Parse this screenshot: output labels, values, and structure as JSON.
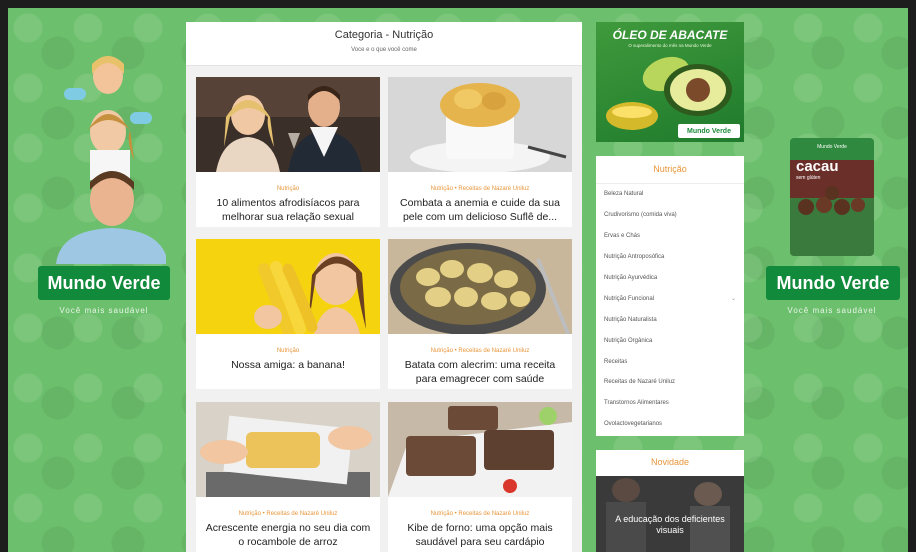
{
  "left_ad": {
    "brand": "Mundo Verde",
    "slogan": "Você mais saudável"
  },
  "right_ad": {
    "brand": "Mundo Verde",
    "slogan": "Você mais saudável",
    "product_brand": "Mundo Verde",
    "product_name": "cacau",
    "product_flag": "sem glúten"
  },
  "category": {
    "title": "Categoria - Nutrição",
    "subtitle": "Voce e o que você come"
  },
  "posts": [
    {
      "tag": "Nutrição",
      "title": "10 alimentos afrodisíacos para melhorar sua relação sexual"
    },
    {
      "tag": "Nutrição • Receitas de Nazaré Uniluz",
      "title": "Combata a anemia e cuide da sua pele com um delicioso Suflê de..."
    },
    {
      "tag": "Nutrição",
      "title": "Nossa amiga: a banana!"
    },
    {
      "tag": "Nutrição • Receitas de Nazaré Uniluz",
      "title": "Batata com alecrim: uma receita para emagrecer com saúde"
    },
    {
      "tag": "Nutrição • Receitas de Nazaré Uniluz",
      "title": "Acrescente energia no seu dia com o rocambole de arroz"
    },
    {
      "tag": "Nutrição • Receitas de Nazaré Uniluz",
      "title": "Kibe de forno: uma opção mais saudável para seu cardápio"
    }
  ],
  "top_ad": {
    "title": "ÓLEO DE ABACATE",
    "subtitle": "O superalimento do mês na Mundo Verde",
    "brand": "Mundo Verde"
  },
  "sidebar": {
    "heading": "Nutrição",
    "items": [
      "Beleza Natural",
      "Crudivorismo (comida viva)",
      "Ervas e Chás",
      "Nutrição Antroposófica",
      "Nutrição Ayurvédica",
      "Nutrição Funcional",
      "Nutrição Naturalista",
      "Nutrição Orgânica",
      "Receitas",
      "Receitas de Nazaré Uniluz",
      "Transtornos Alimentares",
      "Ovolactovegetarianos"
    ]
  },
  "novidade": {
    "heading": "Novidade",
    "caption": "A educação dos deficientes visuais"
  },
  "colors": {
    "accent": "#e8953a",
    "brand_green": "#128a3c",
    "page_bg": "#6cbf6c"
  }
}
